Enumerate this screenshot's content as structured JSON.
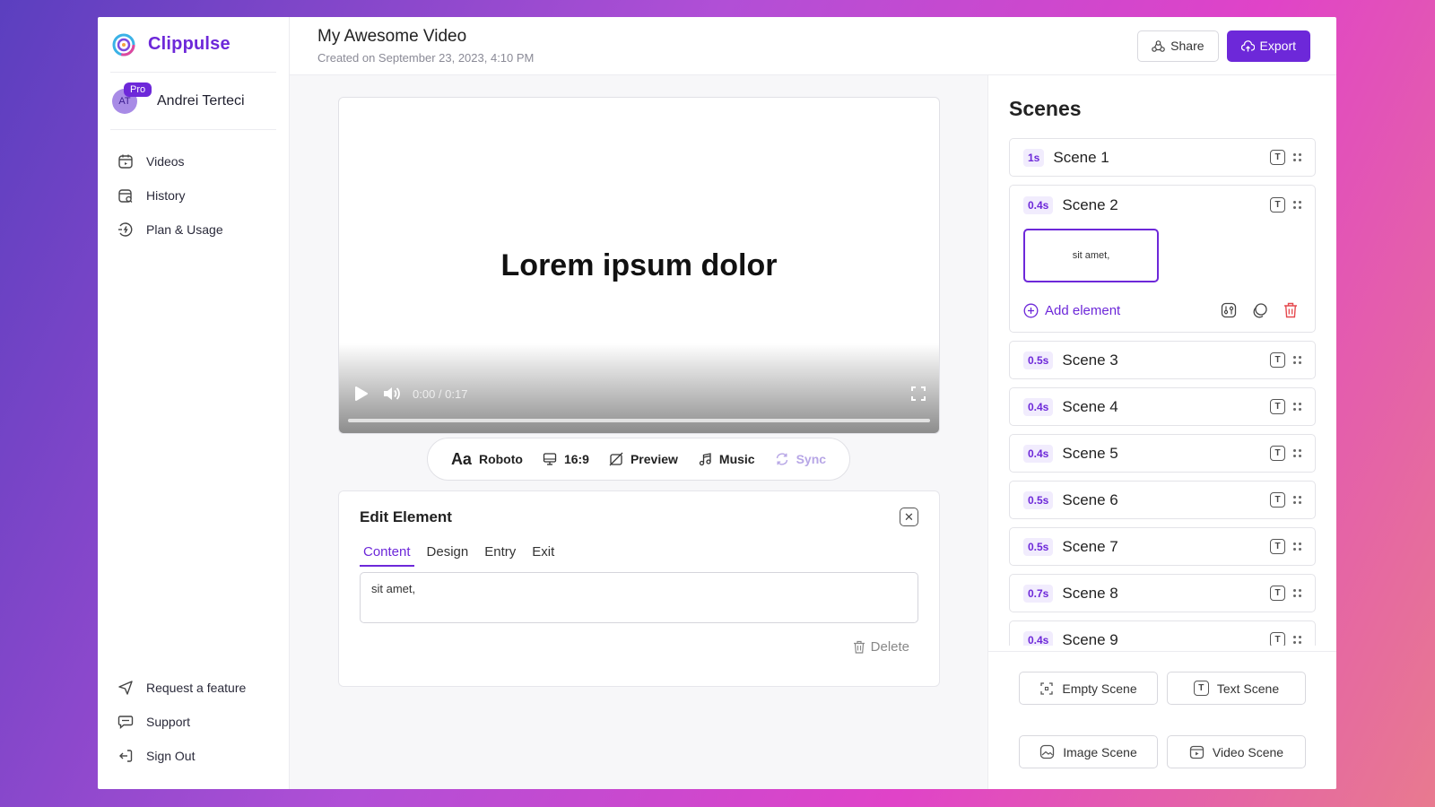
{
  "brand": {
    "name": "Clippulse"
  },
  "user": {
    "initials": "AT",
    "badge": "Pro",
    "name": "Andrei Terteci"
  },
  "nav": {
    "videos": "Videos",
    "history": "History",
    "plan": "Plan & Usage",
    "request": "Request a feature",
    "support": "Support",
    "signout": "Sign Out"
  },
  "header": {
    "title": "My Awesome Video",
    "subtitle": "Created on September 23, 2023, 4:10 PM",
    "share_label": "Share",
    "export_label": "Export"
  },
  "player": {
    "text": "Lorem ipsum dolor",
    "time": "0:00 / 0:17"
  },
  "toolbar": {
    "font_glyph": "Aa",
    "font": "Roboto",
    "ratio": "16:9",
    "preview": "Preview",
    "music": "Music",
    "sync": "Sync"
  },
  "edit_panel": {
    "title": "Edit Element",
    "tabs": [
      "Content",
      "Design",
      "Entry",
      "Exit"
    ],
    "content": "sit amet,",
    "delete_label": "Delete"
  },
  "scenes": {
    "title": "Scenes",
    "icon_letter": "T",
    "items": [
      {
        "duration": "1s",
        "name": "Scene 1"
      },
      {
        "duration": "0.4s",
        "name": "Scene 2",
        "element": "sit amet,",
        "add_label": "Add element"
      },
      {
        "duration": "0.5s",
        "name": "Scene 3"
      },
      {
        "duration": "0.4s",
        "name": "Scene 4"
      },
      {
        "duration": "0.4s",
        "name": "Scene 5"
      },
      {
        "duration": "0.5s",
        "name": "Scene 6"
      },
      {
        "duration": "0.5s",
        "name": "Scene 7"
      },
      {
        "duration": "0.7s",
        "name": "Scene 8"
      },
      {
        "duration": "0.4s",
        "name": "Scene 9"
      }
    ],
    "actions": {
      "empty": "Empty Scene",
      "text": "Text Scene",
      "image": "Image Scene",
      "video": "Video Scene"
    }
  },
  "colors": {
    "accent": "#6d28d9",
    "danger": "#e5484d"
  }
}
